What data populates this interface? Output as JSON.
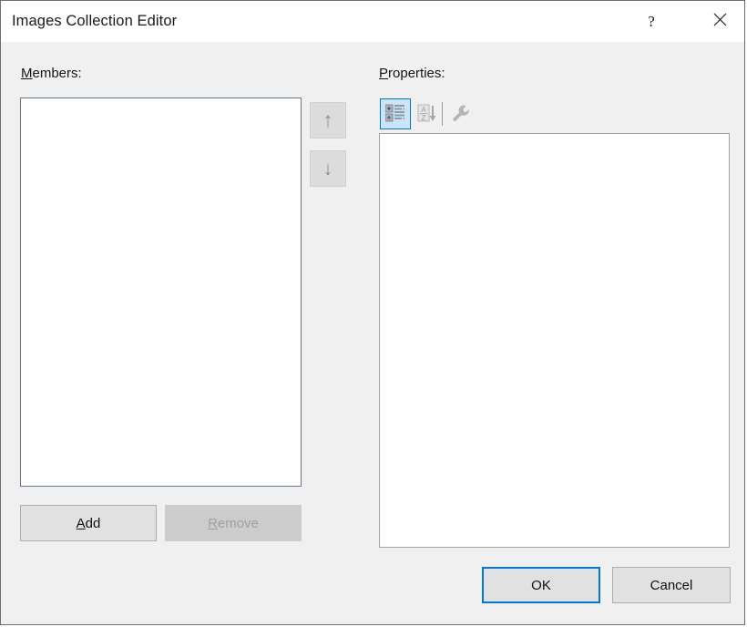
{
  "window": {
    "title": "Images Collection Editor",
    "background_color": "#f0f0f0",
    "titlebar_color": "#ffffff",
    "accent_color": "#0078d7",
    "border_color": "#6e6e6e"
  },
  "titlebar": {
    "help_label": "?",
    "help_icon": "question-mark-icon",
    "close_label": "✕",
    "close_icon": "close-icon"
  },
  "members": {
    "label_prefix": "",
    "label_accel": "M",
    "label_suffix": "embers:",
    "label_full": "Members:",
    "items": []
  },
  "move_buttons": {
    "up_label": "↑",
    "up_icon": "arrow-up-icon",
    "up_enabled": false,
    "down_label": "↓",
    "down_icon": "arrow-down-icon",
    "down_enabled": false
  },
  "properties": {
    "label_accel": "P",
    "label_suffix": "roperties:",
    "label_full": "Properties:",
    "rows": [],
    "toolbar": {
      "categorized": {
        "icon": "categorized-view-icon",
        "selected": true
      },
      "alphabetical": {
        "icon": "alphabetical-sort-icon",
        "selected": false
      },
      "property_pages": {
        "icon": "wrench-icon",
        "selected": false
      }
    }
  },
  "list_buttons": {
    "add_accel": "A",
    "add_suffix": "dd",
    "add_label": "Add",
    "add_enabled": true,
    "remove_accel": "R",
    "remove_suffix": "emove",
    "remove_label": "Remove",
    "remove_enabled": false
  },
  "dialog_buttons": {
    "ok_label": "OK",
    "ok_default": true,
    "cancel_label": "Cancel",
    "cancel_default": false
  }
}
